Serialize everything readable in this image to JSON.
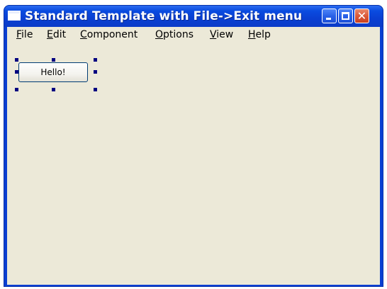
{
  "window": {
    "title": "Standard Template with File->Exit menu",
    "titlebar_color": "#0a3fd2",
    "client_color": "#ece9d8"
  },
  "titlebar": {
    "buttons": [
      {
        "name": "minimize",
        "icon": "minimize-icon"
      },
      {
        "name": "maximize",
        "icon": "maximize-icon"
      },
      {
        "name": "close",
        "icon": "close-icon",
        "glyph": "✕"
      }
    ]
  },
  "menubar": {
    "items": [
      {
        "mnemonic": "F",
        "rest": "ile"
      },
      {
        "mnemonic": "E",
        "rest": "dit"
      },
      {
        "mnemonic": "C",
        "rest": "omponent"
      },
      {
        "mnemonic": "O",
        "rest": "ptions"
      },
      {
        "mnemonic": "V",
        "rest": "iew"
      },
      {
        "mnemonic": "H",
        "rest": "elp"
      }
    ]
  },
  "canvas": {
    "button_label": "Hello!",
    "selected": true,
    "handle_color": "#000080"
  }
}
